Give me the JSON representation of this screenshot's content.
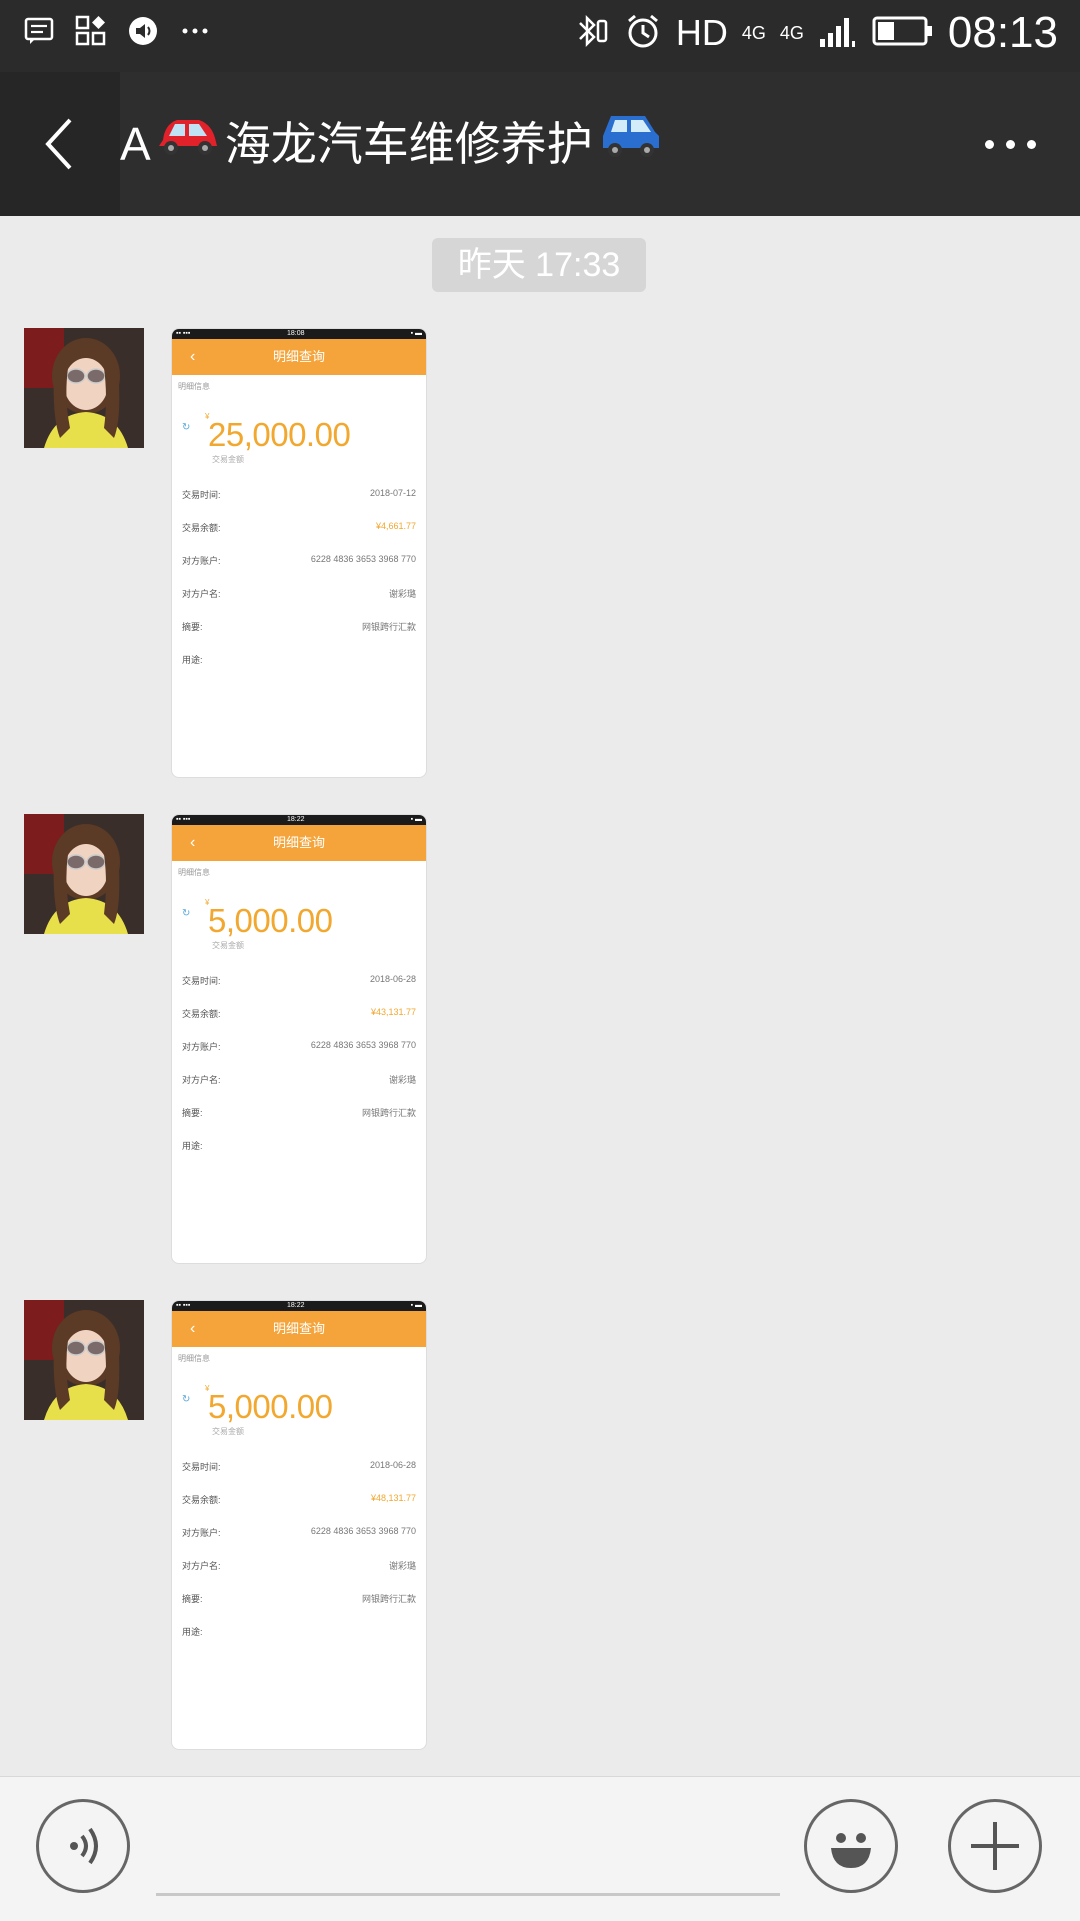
{
  "status_bar": {
    "network_label": "HD",
    "net_4g_a": "4G",
    "net_4g_b": "4G",
    "time": "08:13"
  },
  "header": {
    "title_prefix": "A",
    "title_main": "海龙汽车维修养护",
    "back_icon": "chevron-left-icon",
    "more_icon": "more-dots-icon"
  },
  "chat": {
    "timestamp": "昨天 17:33",
    "messages": [
      {
        "phone_time": "18:08",
        "header_title": "明细查询",
        "info_label": "明细信息",
        "amount": "25,000.00",
        "amount_sub": "交易金额",
        "rows": [
          {
            "label": "交易时间:",
            "value": "2018-07-12"
          },
          {
            "label": "交易余额:",
            "value": "¥4,661.77"
          },
          {
            "label": "对方账户:",
            "value": "6228 4836 3653 3968 770"
          },
          {
            "label": "对方户名:",
            "value": "谢彩璐"
          },
          {
            "label": "摘要:",
            "value": "网银跨行汇款"
          },
          {
            "label": "用途:",
            "value": ""
          }
        ]
      },
      {
        "phone_time": "18:22",
        "header_title": "明细查询",
        "info_label": "明细信息",
        "amount": "5,000.00",
        "amount_sub": "交易金额",
        "rows": [
          {
            "label": "交易时间:",
            "value": "2018-06-28"
          },
          {
            "label": "交易余额:",
            "value": "¥43,131.77"
          },
          {
            "label": "对方账户:",
            "value": "6228 4836 3653 3968 770"
          },
          {
            "label": "对方户名:",
            "value": "谢彩璐"
          },
          {
            "label": "摘要:",
            "value": "网银跨行汇款"
          },
          {
            "label": "用途:",
            "value": ""
          }
        ]
      },
      {
        "phone_time": "18:22",
        "header_title": "明细查询",
        "info_label": "明细信息",
        "amount": "5,000.00",
        "amount_sub": "交易金额",
        "rows": [
          {
            "label": "交易时间:",
            "value": "2018-06-28"
          },
          {
            "label": "交易余额:",
            "value": "¥48,131.77"
          },
          {
            "label": "对方账户:",
            "value": "6228 4836 3653 3968 770"
          },
          {
            "label": "对方户名:",
            "value": "谢彩璐"
          },
          {
            "label": "摘要:",
            "value": "网银跨行汇款"
          },
          {
            "label": "用途:",
            "value": ""
          }
        ]
      }
    ]
  },
  "input_bar": {
    "voice_icon": "voice-icon",
    "emoji_icon": "emoji-icon",
    "plus_icon": "plus-icon"
  },
  "colors": {
    "accent_orange": "#f4a43a",
    "amount_orange": "#f2a72e",
    "chat_bg": "#ebebeb",
    "title_bar": "#2e2e2e"
  }
}
